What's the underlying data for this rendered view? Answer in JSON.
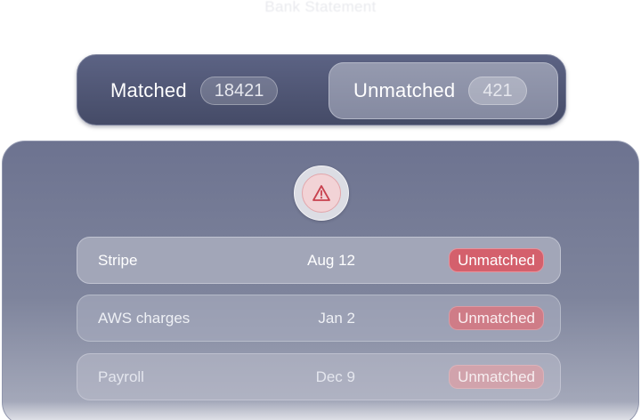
{
  "header": {
    "ghost_title": "Bank Statement"
  },
  "toggle": {
    "matched": {
      "label": "Matched",
      "count": "18421"
    },
    "unmatched": {
      "label": "Unmatched",
      "count": "421"
    },
    "selected": "unmatched"
  },
  "alert": {
    "icon": "warning-triangle-icon"
  },
  "rows": [
    {
      "name": "Stripe",
      "date": "Aug 12",
      "status": "Unmatched"
    },
    {
      "name": "AWS charges",
      "date": "Jan 2",
      "status": "Unmatched"
    },
    {
      "name": "Payroll",
      "date": "Dec 9",
      "status": "Unmatched"
    }
  ],
  "colors": {
    "toggle_bg": "#4f5573",
    "panel_bg": "#767c96",
    "status_unmatched": "#d4606c",
    "alert_accent": "#c8414e"
  }
}
